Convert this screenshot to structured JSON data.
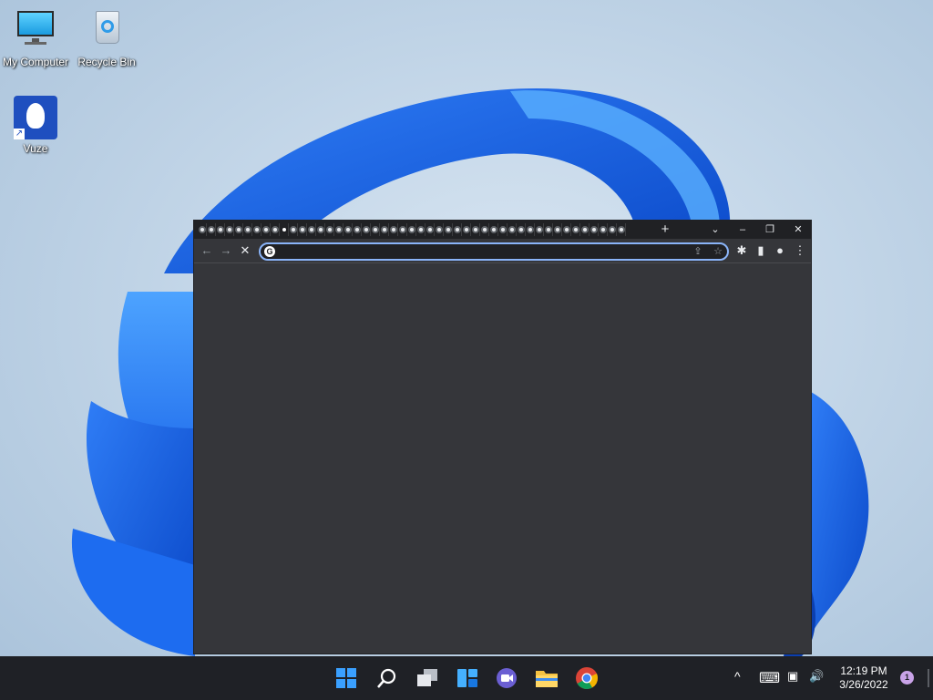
{
  "desktop": {
    "icons": [
      {
        "label": "My Computer",
        "icon": "monitor-icon"
      },
      {
        "label": "Recycle Bin",
        "icon": "recycle-bin-icon"
      },
      {
        "label": "Vuze",
        "icon": "vuze-frog-icon"
      }
    ]
  },
  "browser": {
    "tab_count": 47,
    "new_tab_label": "+",
    "tab_search_glyph": "⌄",
    "minimize_glyph": "–",
    "restore_glyph": "❐",
    "close_glyph": "✕",
    "back_glyph": "←",
    "forward_glyph": "→",
    "stop_glyph": "✕",
    "omnibox": {
      "value": "",
      "placeholder": "",
      "favicon_letter": "G"
    },
    "share_glyph": "⇪",
    "bookmark_glyph": "☆",
    "extensions_glyph": "✱",
    "side_panel_glyph": "▮",
    "profile_glyph": "●",
    "menu_glyph": "⋮"
  },
  "taskbar": {
    "apps": [
      "start-icon",
      "search-icon",
      "task-view-icon",
      "widgets-icon",
      "teams-chat-icon",
      "file-explorer-icon",
      "chrome-icon"
    ],
    "tray": {
      "chevron_glyph": "^",
      "keyboard_glyph": "⌨",
      "network_glyph": "▣",
      "volume_glyph": "🔊"
    },
    "clock": {
      "time": "12:19 PM",
      "date": "3/26/2022"
    },
    "notification_count": "1"
  },
  "colors": {
    "accent": "#8ab4f8",
    "browser_frame": "#202124",
    "browser_toolbar": "#35363a",
    "taskbar": "#1f2126"
  }
}
